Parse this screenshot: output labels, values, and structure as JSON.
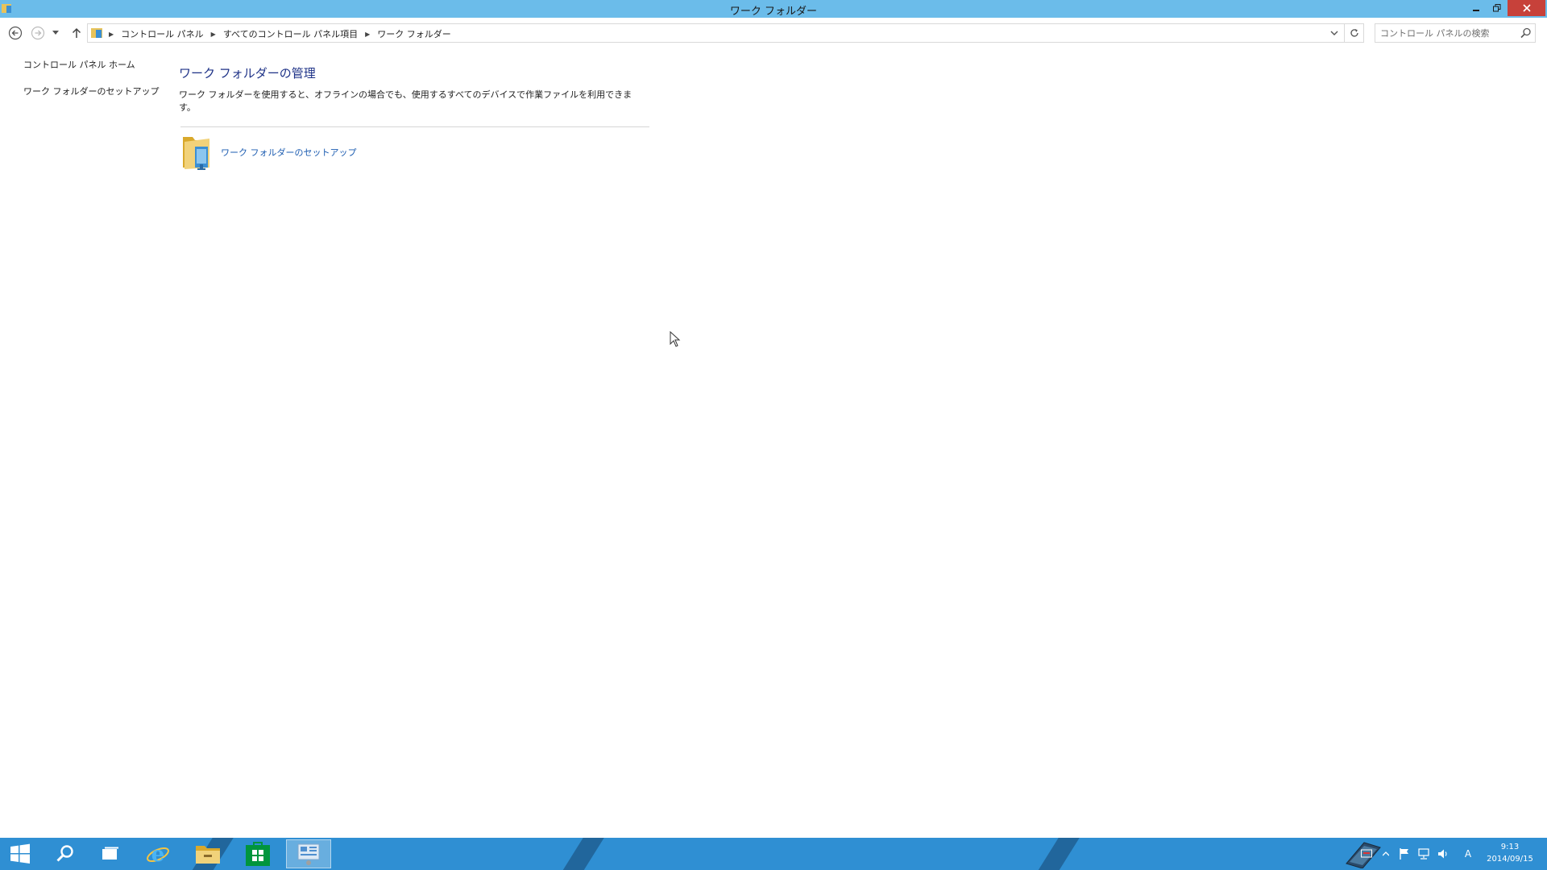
{
  "window": {
    "title": "ワーク フォルダー"
  },
  "address_bar": {
    "breadcrumbs": [
      "コントロール パネル",
      "すべてのコントロール パネル項目",
      "ワーク フォルダー"
    ],
    "search_placeholder": "コントロール パネルの検索"
  },
  "left_pane": {
    "links": [
      "コントロール パネル ホーム",
      "ワーク フォルダーのセットアップ"
    ]
  },
  "main": {
    "heading": "ワーク フォルダーの管理",
    "description": "ワーク フォルダーを使用すると、オフラインの場合でも、使用するすべてのデバイスで作業ファイルを利用できます。",
    "task_link": "ワーク フォルダーのセットアップ"
  },
  "taskbar": {
    "pinned": [
      "start-icon",
      "search-icon",
      "task-view-icon",
      "internet-explorer-icon",
      "file-explorer-icon",
      "store-icon",
      "control-panel-icon"
    ],
    "clock_time": "9:13",
    "clock_date": "2014/09/15",
    "ime_indicator": "A"
  },
  "colors": {
    "titlebar": "#6bbcea",
    "taskbar": "#2f8fd3",
    "close_button": "#c7413a",
    "heading": "#1e3287",
    "link": "#1a5bb0"
  }
}
